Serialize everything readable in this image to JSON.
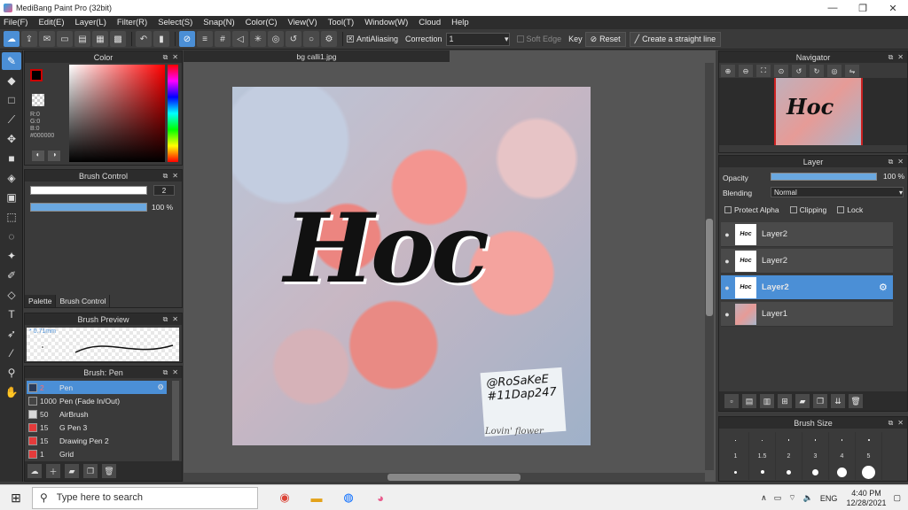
{
  "window": {
    "title": "MediBang Paint Pro (32bit)",
    "minimize": "—",
    "maximize": "❐",
    "close": "✕"
  },
  "menu": [
    "File(F)",
    "Edit(E)",
    "Layer(L)",
    "Filter(R)",
    "Select(S)",
    "Snap(N)",
    "Color(C)",
    "View(V)",
    "Tool(T)",
    "Window(W)",
    "Cloud",
    "Help"
  ],
  "toolbar": {
    "antialiasing_label": "AntiAliasing",
    "correction_label": "Correction",
    "correction_value": "1",
    "soft_edge_label": "Soft Edge",
    "key_label": "Key",
    "reset_label": "Reset",
    "straight_line_label": "Create a straight line"
  },
  "color_panel": {
    "title": "Color",
    "r": "R:0",
    "g": "G:0",
    "b": "B:0",
    "hex": "#000000",
    "fg": "#000000",
    "bg": "#ffffff"
  },
  "brush_control": {
    "title": "Brush Control",
    "size_value": "2",
    "opacity_value": "100 %"
  },
  "panel_tabs": {
    "palette": "Palette",
    "brush_control": "Brush Control"
  },
  "brush_preview": {
    "title": "Brush Preview",
    "size_text": "* 0.71mm"
  },
  "brush_list": {
    "title": "Brush: Pen",
    "items": [
      {
        "num": "2",
        "name": "Pen",
        "color": "#2a3b5a",
        "selected": true
      },
      {
        "num": "1000",
        "name": "Pen (Fade In/Out)",
        "color": "#444444",
        "selected": false
      },
      {
        "num": "50",
        "name": "AirBrush",
        "color": "#d9d9d9",
        "selected": false
      },
      {
        "num": "15",
        "name": "G Pen 3",
        "color": "#e53b3b",
        "selected": false
      },
      {
        "num": "15",
        "name": "Drawing Pen 2",
        "color": "#e53b3b",
        "selected": false
      },
      {
        "num": "1",
        "name": "Grid",
        "color": "#e53b3b",
        "selected": false
      }
    ]
  },
  "document": {
    "tab_name": "bg calli1.jpg",
    "art_text": "Hoc",
    "note_line1": "@RoSaKeE",
    "note_line2": "#11Dap247",
    "caption": "Lovin' flower"
  },
  "navigator": {
    "title": "Navigator",
    "thumb_text": "Hoc"
  },
  "layer_panel": {
    "title": "Layer",
    "opacity_label": "Opacity",
    "opacity_value": "100 %",
    "opacity_fraction": 1.0,
    "blending_label": "Blending",
    "blending_value": "Normal",
    "protect_alpha": "Protect Alpha",
    "clipping": "Clipping",
    "lock": "Lock",
    "layers": [
      {
        "name": "Layer2",
        "thumb": "Hoc",
        "selected": false
      },
      {
        "name": "Layer2",
        "thumb": "Hoc",
        "selected": false
      },
      {
        "name": "Layer2",
        "thumb": "Hoc",
        "selected": true
      },
      {
        "name": "Layer1",
        "thumb": "",
        "selected": false
      }
    ]
  },
  "brush_size": {
    "title": "Brush Size",
    "row1": [
      "",
      "",
      "",
      "",
      "",
      ""
    ],
    "row2": [
      "1",
      "1.5",
      "2",
      "3",
      "4",
      "5"
    ]
  },
  "taskbar": {
    "search_placeholder": "Type here to search",
    "lang": "ENG",
    "time": "4:40 PM",
    "date": "12/28/2021"
  },
  "colors": {
    "accent": "#4b8fd6",
    "panel": "#3a3a3a",
    "header": "#2c2c2c"
  }
}
